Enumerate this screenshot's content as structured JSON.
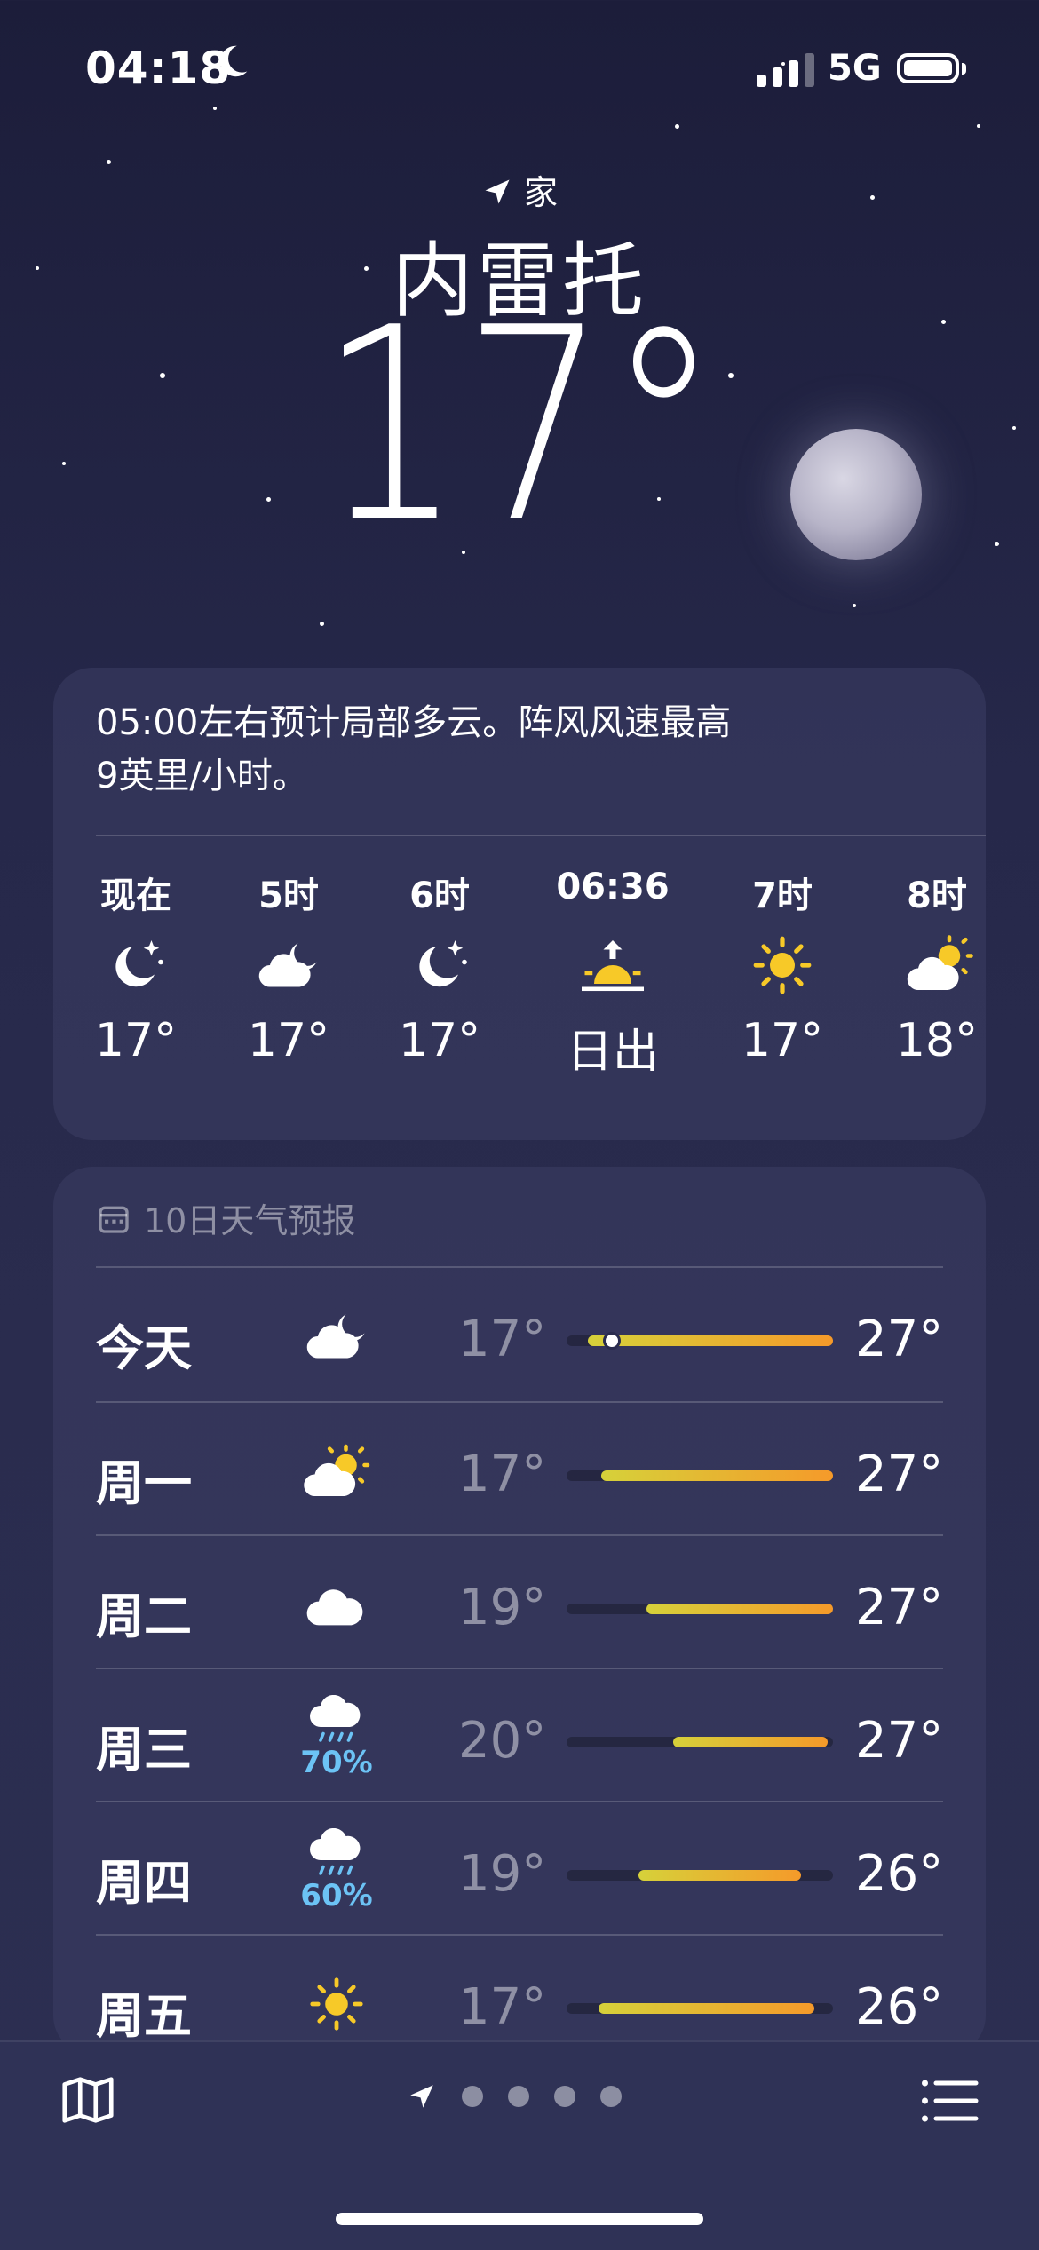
{
  "status": {
    "time": "04:18",
    "network": "5G"
  },
  "header": {
    "location_label": "家",
    "city": "内雷托",
    "temperature": "17°"
  },
  "summary": {
    "text_line1": "05:00左右预计局部多云。阵风风速最高",
    "text_line2": "9英里/小时。",
    "hours": [
      {
        "label": "现在",
        "icon": "moon-stars-icon",
        "value": "17°"
      },
      {
        "label": "5时",
        "icon": "cloud-moon-icon",
        "value": "17°"
      },
      {
        "label": "6时",
        "icon": "moon-stars-icon",
        "value": "17°"
      },
      {
        "label": "06:36",
        "icon": "sunrise-icon",
        "value": "日出"
      },
      {
        "label": "7时",
        "icon": "sun-icon",
        "value": "17°"
      },
      {
        "label": "8时",
        "icon": "cloud-sun-icon",
        "value": "18°"
      }
    ]
  },
  "forecast": {
    "title": "10日天气预报",
    "days": [
      {
        "day": "今天",
        "icon": "cloud-moon-icon",
        "low": "17°",
        "high": "27°",
        "range_start": 0.08,
        "range_end": 1.0,
        "current": 0.17
      },
      {
        "day": "周一",
        "icon": "cloud-sun-icon",
        "low": "17°",
        "high": "27°",
        "range_start": 0.13,
        "range_end": 1.0
      },
      {
        "day": "周二",
        "icon": "cloud-icon",
        "low": "19°",
        "high": "27°",
        "range_start": 0.3,
        "range_end": 1.0
      },
      {
        "day": "周三",
        "icon": "cloud-rain-icon",
        "pop": "70%",
        "low": "20°",
        "high": "27°",
        "range_start": 0.4,
        "range_end": 0.98
      },
      {
        "day": "周四",
        "icon": "cloud-rain-icon",
        "pop": "60%",
        "low": "19°",
        "high": "26°",
        "range_start": 0.27,
        "range_end": 0.88
      },
      {
        "day": "周五",
        "icon": "sun-icon",
        "low": "17°",
        "high": "26°",
        "range_start": 0.12,
        "range_end": 0.93
      }
    ]
  },
  "colors": {
    "sun": "#f7c928",
    "rain": "#6cc3f5",
    "bar_warm": "#f59a2a",
    "bar_mild": "#d6d13a"
  }
}
